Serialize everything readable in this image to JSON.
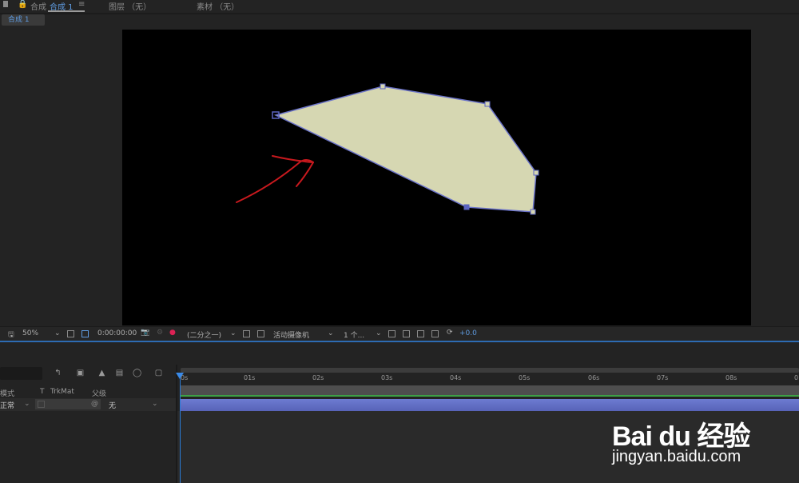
{
  "panels": {
    "tab_composition_prefix": "合成",
    "tab_composition_name": "合成 1",
    "tab_layer": "图层 （无）",
    "tab_footage": "素材 （无）"
  },
  "comp_tab": {
    "label": "合成 1"
  },
  "viewer_toolbar": {
    "zoom": "50%",
    "timecode": "0:00:00:00",
    "resolution": "(二分之一)",
    "camera": "活动摄像机",
    "views": "1 个...",
    "exposure": "+0.0"
  },
  "timeline": {
    "col_mode": "模式",
    "col_t": "T",
    "col_trkmat": "TrkMat",
    "col_parent": "父级",
    "layer": {
      "mode": "正常",
      "parent": "无"
    },
    "ruler_labels": [
      "0s",
      "01s",
      "02s",
      "03s",
      "04s",
      "05s",
      "06s",
      "07s",
      "08s",
      "0"
    ]
  },
  "colors": {
    "shape_fill": "#d6d7b2",
    "shape_stroke": "#6b73c8",
    "annotation": "#c8191e",
    "accent": "#2d6bb3",
    "layer_bar": "#6d7bd1"
  },
  "watermark": {
    "logo": "Bai du 经验",
    "url": "jingyan.baidu.com"
  }
}
